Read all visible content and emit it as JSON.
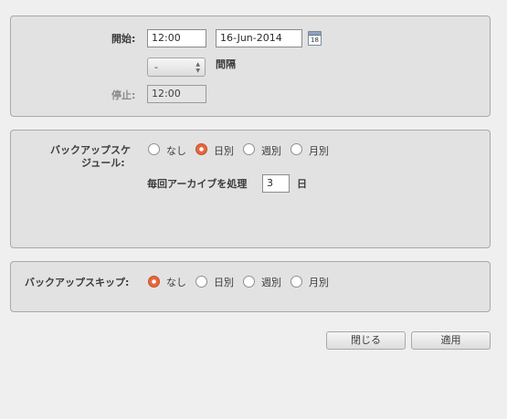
{
  "schedule": {
    "start_label": "開始:",
    "start_time": "12:00",
    "start_date": "16-Jun-2014",
    "calendar_day": "18",
    "interval_value": "-",
    "interval_label": "間隔",
    "stop_label": "停止:",
    "stop_time": "12:00"
  },
  "backup_schedule": {
    "label_line1": "バックアップスケ",
    "label_line2": "ジュール:",
    "options": [
      "なし",
      "日別",
      "週別",
      "月別"
    ],
    "selected": "日別",
    "archive_label": "毎回アーカイブを処理",
    "archive_value": "3",
    "archive_unit": "日"
  },
  "backup_skip": {
    "label": "バックアップスキップ:",
    "options": [
      "なし",
      "日別",
      "週別",
      "月別"
    ],
    "selected": "なし"
  },
  "buttons": {
    "close": "閉じる",
    "apply": "適用"
  },
  "colors": {
    "radio_selected": "#e8663b"
  }
}
